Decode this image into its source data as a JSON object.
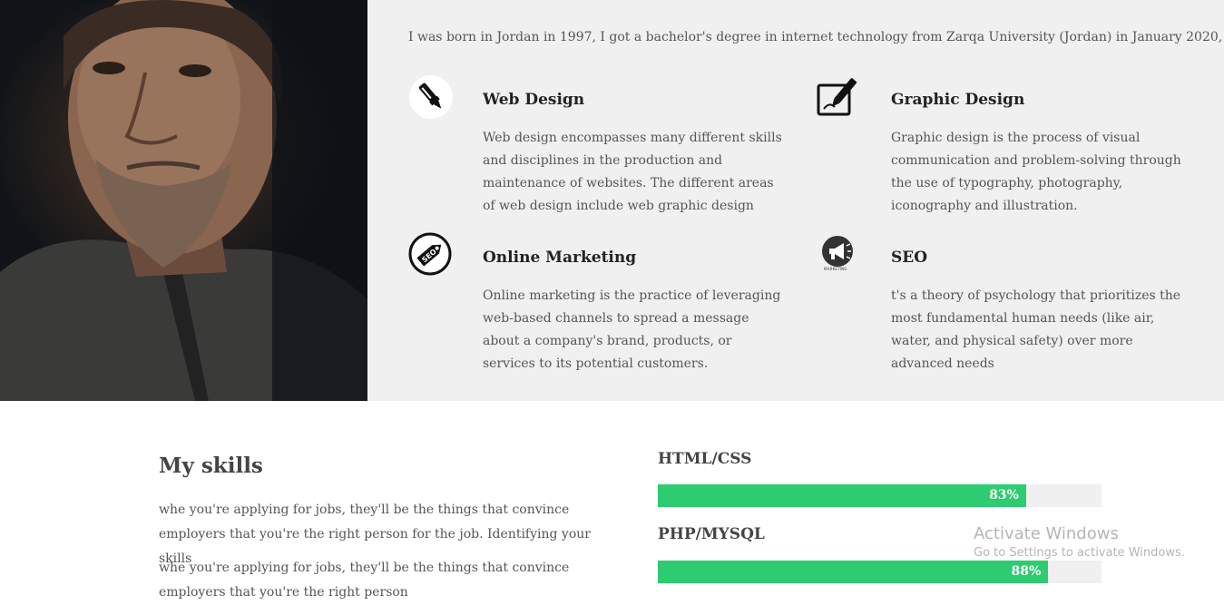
{
  "intro": "I was born in Jordan in 1997, I got a bachelor's degree in internet technology from Zarqa University (Jordan) in January 2020,",
  "services": [
    {
      "title": "Web Design",
      "description": "Web design encompasses many different skills and disciplines in the production and maintenance of websites. The different areas of web design include web graphic design",
      "icon": "marker-icon"
    },
    {
      "title": "Graphic Design",
      "description": "Graphic design is the process of visual communication and problem-solving through the use of typography, photography, iconography and illustration.",
      "icon": "pen-tablet-icon"
    },
    {
      "title": "Online Marketing",
      "description": "Online marketing is the practice of leveraging web-based channels to spread a message about a company's brand, products, or services to its potential customers.",
      "icon": "seo-tag-icon"
    },
    {
      "title": "SEO",
      "description": "t's a theory of psychology that prioritizes the most fundamental human needs (like air, water, and physical safety) over more advanced needs",
      "icon": "megaphone-icon",
      "icon_caption": "MARKETING"
    }
  ],
  "skills": {
    "title": "My skills",
    "paragraphs": [
      "whe you're applying for jobs, they'll be the things that convince employers that you're the right person for the job. Identifying your skills",
      "whe you're applying for jobs, they'll be the things that convince employers that you're the right person"
    ],
    "bars": [
      {
        "label": "HTML/CSS",
        "percent": 83,
        "percent_label": "83%"
      },
      {
        "label": "PHP/MYSQL",
        "percent": 88,
        "percent_label": "88%"
      }
    ],
    "bar_color": "#2ecc71"
  },
  "watermark": {
    "title": "Activate Windows",
    "subtitle": "Go to Settings to activate Windows."
  }
}
